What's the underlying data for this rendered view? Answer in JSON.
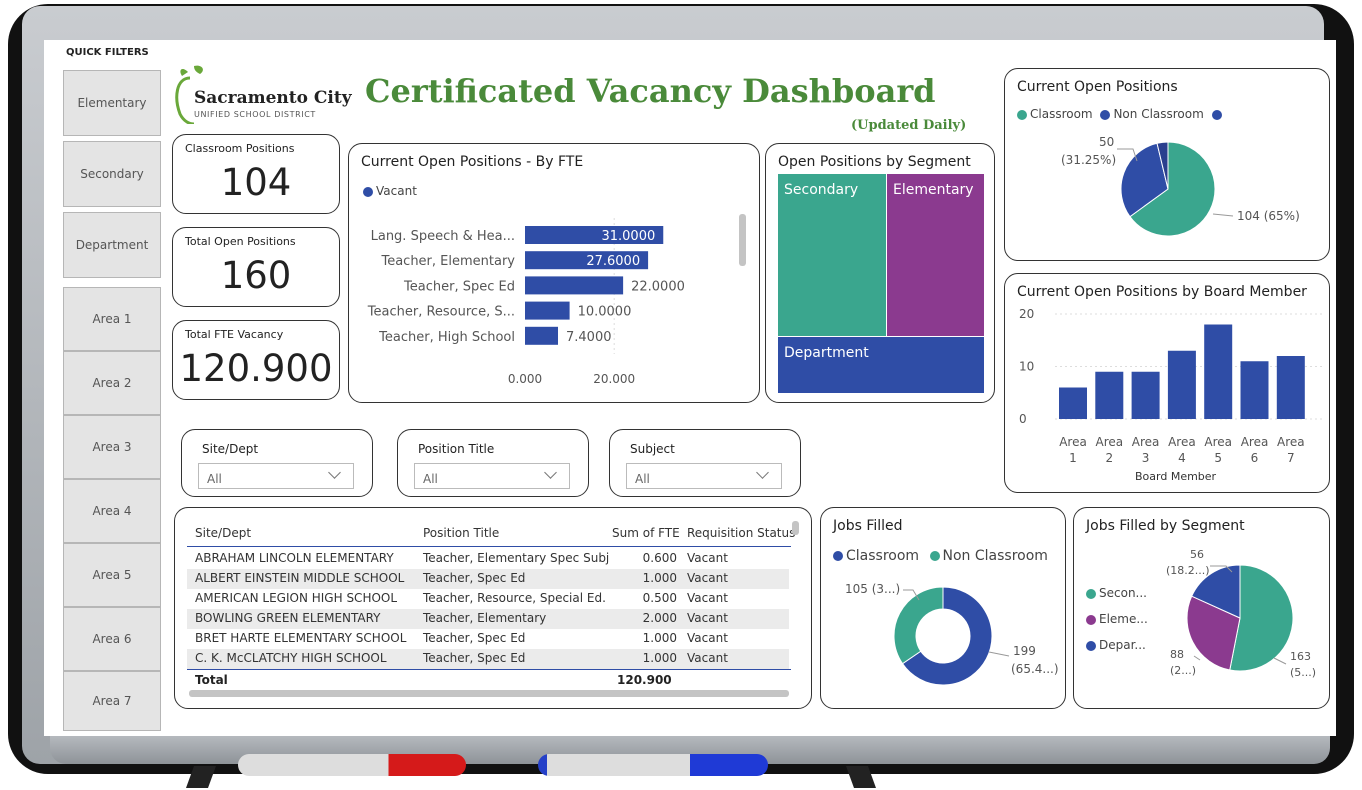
{
  "header": {
    "logo_name": "Sacramento City",
    "logo_sub": "UNIFIED SCHOOL DISTRICT",
    "title": "Certificated Vacancy Dashboard",
    "subtitle": "(Updated Daily)"
  },
  "quick_filters": {
    "title": "QUICK FILTERS",
    "items": [
      "Elementary",
      "Secondary",
      "Department",
      "Area 1",
      "Area 2",
      "Area 3",
      "Area 4",
      "Area 5",
      "Area 6",
      "Area 7"
    ]
  },
  "kpis": {
    "classroom": {
      "label": "Classroom Positions",
      "value": "104"
    },
    "total_open": {
      "label": "Total Open Positions",
      "value": "160"
    },
    "fte_vacancy": {
      "label": "Total FTE Vacancy",
      "value": "120.900"
    }
  },
  "slicers": [
    {
      "label": "Site/Dept",
      "value": "All"
    },
    {
      "label": "Position Title",
      "value": "All"
    },
    {
      "label": "Subject",
      "value": "All"
    }
  ],
  "table": {
    "headers": [
      "Site/Dept",
      "Position Title",
      "Sum of FTE",
      "Requisition Status"
    ],
    "rows": [
      [
        "ABRAHAM LINCOLN ELEMENTARY",
        "Teacher, Elementary Spec Subj",
        "0.600",
        "Vacant"
      ],
      [
        "ALBERT EINSTEIN MIDDLE SCHOOL",
        "Teacher, Spec Ed",
        "1.000",
        "Vacant"
      ],
      [
        "AMERICAN LEGION HIGH SCHOOL",
        "Teacher, Resource, Special Ed.",
        "0.500",
        "Vacant"
      ],
      [
        "BOWLING GREEN ELEMENTARY",
        "Teacher, Elementary",
        "2.000",
        "Vacant"
      ],
      [
        "BRET HARTE ELEMENTARY SCHOOL",
        "Teacher, Spec Ed",
        "1.000",
        "Vacant"
      ],
      [
        "C. K. McCLATCHY HIGH SCHOOL",
        "Teacher, Spec Ed",
        "1.000",
        "Vacant"
      ]
    ],
    "total_label": "Total",
    "total_value": "120.900"
  },
  "colors": {
    "blue": "#2f4da6",
    "teal": "#3aa68e",
    "purple": "#8b3a8f",
    "green_title": "#4a8a3a"
  },
  "chart_data": [
    {
      "type": "bar",
      "orientation": "horizontal",
      "title": "Current Open Positions - By FTE",
      "legend": [
        "Vacant"
      ],
      "categories": [
        "Lang. Speech & Hea...",
        "Teacher, Elementary",
        "Teacher, Spec Ed",
        "Teacher, Resource, S...",
        "Teacher, High School"
      ],
      "values": [
        31.0,
        27.6,
        22.0,
        10.0,
        7.4
      ],
      "value_labels": [
        "31.0000",
        "27.6000",
        "22.0000",
        "10.0000",
        "7.4000"
      ],
      "x_ticks": [
        "0.000",
        "20.000"
      ],
      "xlim": [
        0,
        34
      ]
    },
    {
      "type": "treemap",
      "title": "Open Positions by Segment",
      "categories": [
        "Secondary",
        "Elementary",
        "Department"
      ]
    },
    {
      "type": "pie",
      "title": "Current Open Positions",
      "legend": [
        "Classroom",
        "Non Classroom"
      ],
      "values": [
        104,
        50,
        6
      ],
      "labels": [
        "104 (65%)",
        "50\n(31.25%)"
      ]
    },
    {
      "type": "bar",
      "title": "Current Open Positions by Board Member",
      "categories": [
        "Area 1",
        "Area 2",
        "Area 3",
        "Area 4",
        "Area 5",
        "Area 6",
        "Area 7"
      ],
      "values": [
        6,
        9,
        9,
        13,
        18,
        11,
        12
      ],
      "y_ticks": [
        "0",
        "10",
        "20"
      ],
      "ylim": [
        0,
        20
      ],
      "xlabel": "Board Member"
    },
    {
      "type": "pie",
      "donut": true,
      "title": "Jobs Filled",
      "legend": [
        "Classroom",
        "Non Classroom"
      ],
      "values": [
        199,
        105
      ],
      "labels": [
        "199",
        "(65.4...)",
        "105 (3...)"
      ]
    },
    {
      "type": "pie",
      "title": "Jobs Filled by Segment",
      "legend": [
        "Secon...",
        "Eleme...",
        "Depar..."
      ],
      "values": [
        163,
        88,
        56
      ],
      "labels": [
        "163",
        "(5...)",
        "88",
        "(2...)",
        "56",
        "(18.2...)"
      ]
    }
  ]
}
